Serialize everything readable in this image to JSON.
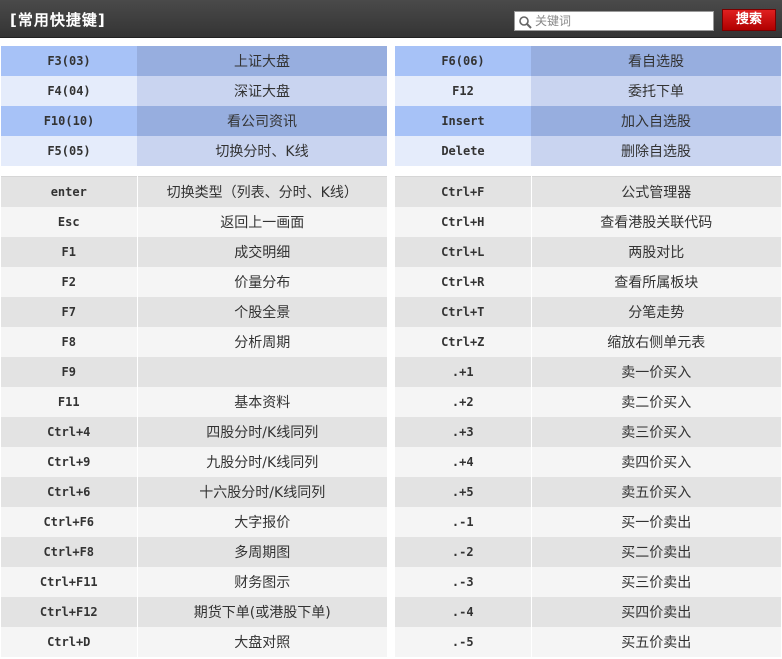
{
  "header": {
    "title": "[常用快捷键]",
    "search_placeholder": "关键词",
    "search_button": "搜索"
  },
  "top_left": [
    {
      "key": "F3(03)",
      "func": "上证大盘"
    },
    {
      "key": "F4(04)",
      "func": "深证大盘"
    },
    {
      "key": "F10(10)",
      "func": "看公司资讯"
    },
    {
      "key": "F5(05)",
      "func": "切换分时、K线"
    }
  ],
  "top_right": [
    {
      "key": "F6(06)",
      "func": "看自选股"
    },
    {
      "key": "F12",
      "func": "委托下单"
    },
    {
      "key": "Insert",
      "func": "加入自选股"
    },
    {
      "key": "Delete",
      "func": "删除自选股"
    }
  ],
  "bottom_left": [
    {
      "key": "enter",
      "func": "切换类型（列表、分时、K线）"
    },
    {
      "key": "Esc",
      "func": "返回上一画面"
    },
    {
      "key": "F1",
      "func": "成交明细"
    },
    {
      "key": "F2",
      "func": "价量分布"
    },
    {
      "key": "F7",
      "func": "个股全景"
    },
    {
      "key": "F8",
      "func": "分析周期"
    },
    {
      "key": "F9",
      "func": ""
    },
    {
      "key": "F11",
      "func": "基本资料"
    },
    {
      "key": "Ctrl+4",
      "func": "四股分时/K线同列"
    },
    {
      "key": "Ctrl+9",
      "func": "九股分时/K线同列"
    },
    {
      "key": "Ctrl+6",
      "func": "十六股分时/K线同列"
    },
    {
      "key": "Ctrl+F6",
      "func": "大字报价"
    },
    {
      "key": "Ctrl+F8",
      "func": "多周期图"
    },
    {
      "key": "Ctrl+F11",
      "func": "财务图示"
    },
    {
      "key": "Ctrl+F12",
      "func": "期货下单(或港股下单)"
    },
    {
      "key": "Ctrl+D",
      "func": "大盘对照"
    }
  ],
  "bottom_right": [
    {
      "key": "Ctrl+F",
      "func": "公式管理器"
    },
    {
      "key": "Ctrl+H",
      "func": "查看港股关联代码"
    },
    {
      "key": "Ctrl+L",
      "func": "两股对比"
    },
    {
      "key": "Ctrl+R",
      "func": "查看所属板块"
    },
    {
      "key": "Ctrl+T",
      "func": "分笔走势"
    },
    {
      "key": "Ctrl+Z",
      "func": "缩放右侧单元表"
    },
    {
      "key": ".+1",
      "func": "卖一价买入"
    },
    {
      "key": ".+2",
      "func": "卖二价买入"
    },
    {
      "key": ".+3",
      "func": "卖三价买入"
    },
    {
      "key": ".+4",
      "func": "卖四价买入"
    },
    {
      "key": ".+5",
      "func": "卖五价买入"
    },
    {
      "key": ".-1",
      "func": "买一价卖出"
    },
    {
      "key": ".-2",
      "func": "买二价卖出"
    },
    {
      "key": ".-3",
      "func": "买三价卖出"
    },
    {
      "key": ".-4",
      "func": "买四价卖出"
    },
    {
      "key": ".-5",
      "func": "买五价卖出"
    }
  ]
}
